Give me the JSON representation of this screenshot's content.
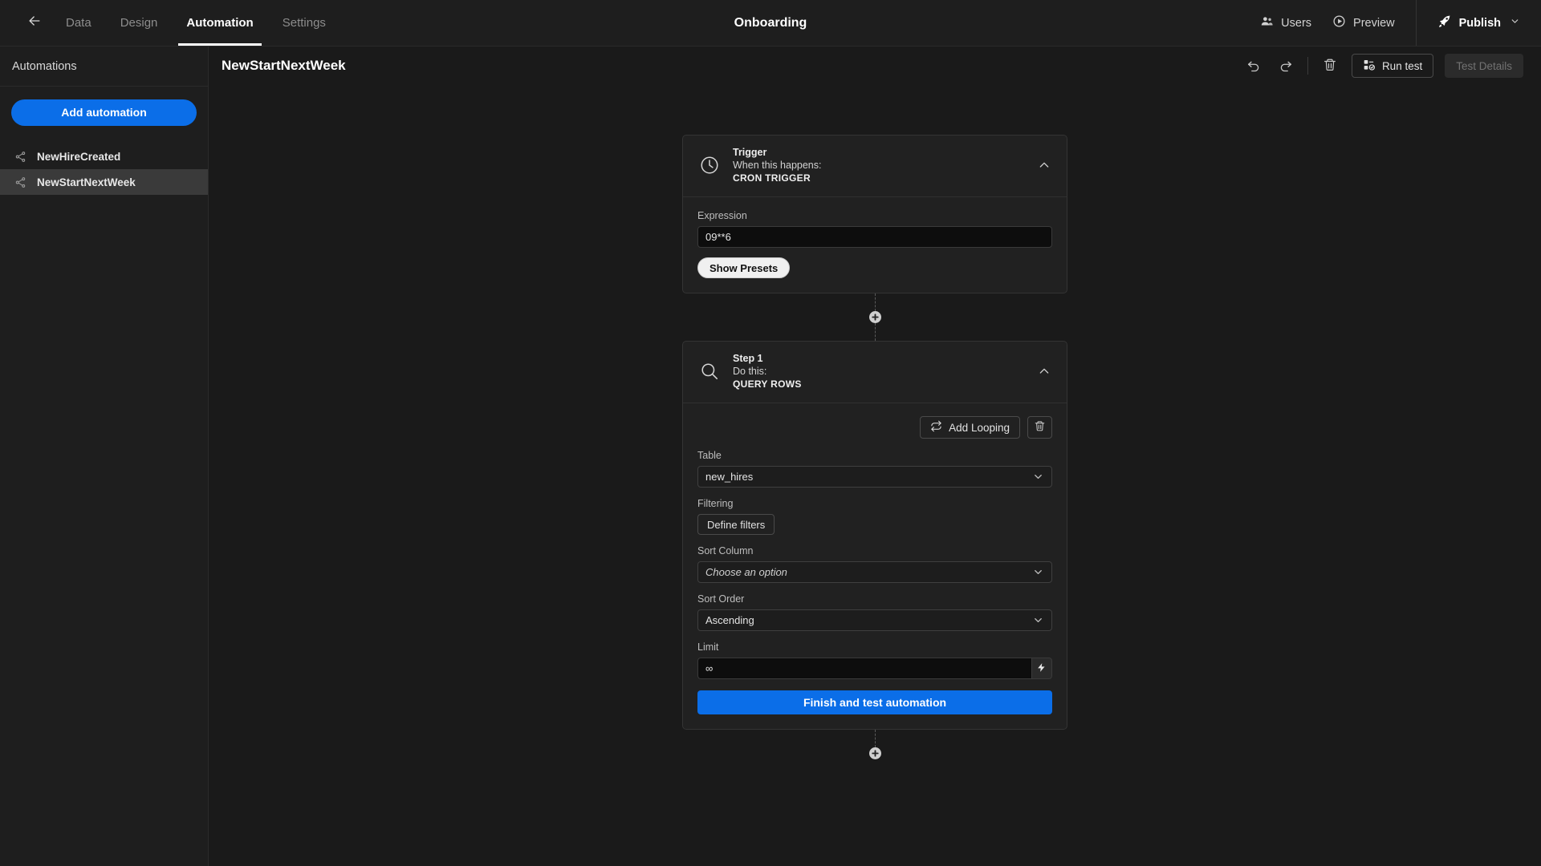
{
  "topnav": {
    "back_icon": "arrow-left-icon",
    "tabs": [
      {
        "label": "Data",
        "active": false
      },
      {
        "label": "Design",
        "active": false
      },
      {
        "label": "Automation",
        "active": true
      },
      {
        "label": "Settings",
        "active": false
      }
    ],
    "title": "Onboarding",
    "users_label": "Users",
    "preview_label": "Preview",
    "publish_label": "Publish",
    "chevron": "⌄"
  },
  "sidebar": {
    "header": "Automations",
    "add_button": "Add automation",
    "items": [
      {
        "label": "NewHireCreated",
        "selected": false
      },
      {
        "label": "NewStartNextWeek",
        "selected": true
      }
    ]
  },
  "main_header": {
    "title": "NewStartNextWeek",
    "undo_icon": "undo-icon",
    "redo_icon": "redo-icon",
    "delete_icon": "trash-icon",
    "run_test_label": "Run test",
    "test_details_label": "Test Details"
  },
  "trigger": {
    "title": "Trigger",
    "subtitle": "When this happens:",
    "kind": "CRON TRIGGER",
    "expression_label": "Expression",
    "expression_value": "09**6",
    "show_presets_label": "Show Presets"
  },
  "step1": {
    "title": "Step 1",
    "subtitle": "Do this:",
    "kind": "QUERY ROWS",
    "add_looping_label": "Add Looping",
    "table_label": "Table",
    "table_value": "new_hires",
    "filtering_label": "Filtering",
    "define_filters_label": "Define filters",
    "sort_column_label": "Sort Column",
    "sort_column_placeholder": "Choose an option",
    "sort_order_label": "Sort Order",
    "sort_order_value": "Ascending",
    "limit_label": "Limit",
    "limit_value": "∞",
    "finish_label": "Finish and test automation"
  },
  "connectors": {
    "plus": "⊕"
  },
  "colors": {
    "accent": "#0b6ee8",
    "canvas_bg": "#1a1a1a",
    "panel_bg": "#1e1e1e",
    "card_bg": "#212121",
    "selected_row": "#3a3a3a"
  }
}
